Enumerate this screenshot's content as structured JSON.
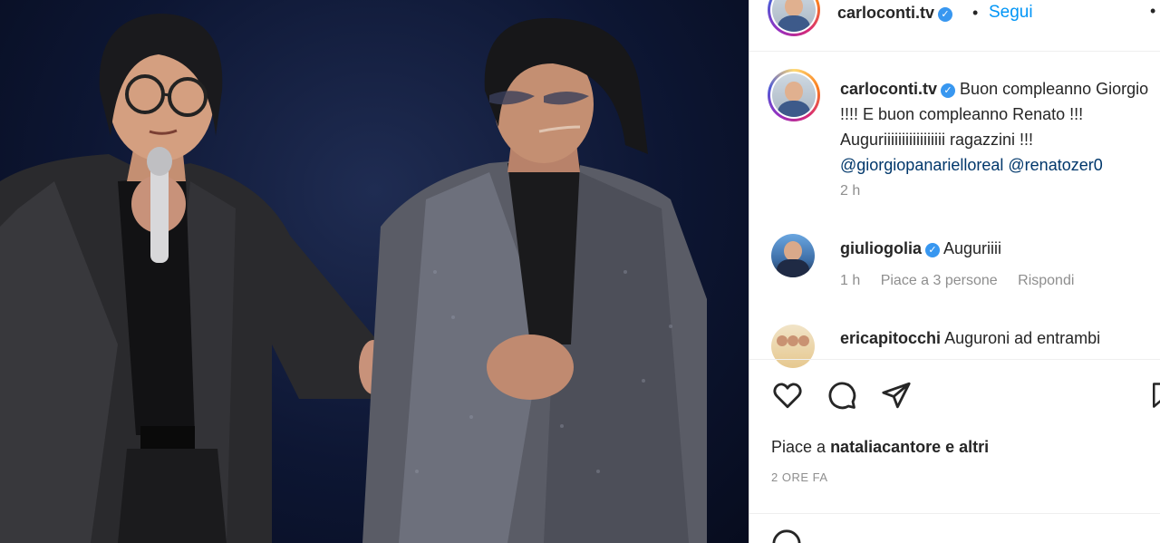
{
  "post": {
    "username": "carloconti.tv",
    "follow_label": "Segui",
    "separator": "•",
    "more_label": "•",
    "caption_text": "Buon compleanno Giorgio !!!! E buon compleanno Renato !!! Auguriiiiiiiiiiiiiiiii ragazzini !!!",
    "caption_tags": [
      "@giorgiopanarielloreal",
      "@renatozer0"
    ],
    "caption_time": "2 h"
  },
  "comments": [
    {
      "username": "giuliogolia",
      "verified": true,
      "text": "Auguriiii",
      "time": "1 h",
      "likes": "Piace a 3 persone",
      "reply": "Rispondi"
    },
    {
      "username": "ericapitocchi",
      "verified": false,
      "text": "Auguroni ad entrambi"
    }
  ],
  "actions": {
    "like_icon": "heart-icon",
    "comment_icon": "comment-icon",
    "share_icon": "share-icon",
    "save_icon": "bookmark-icon"
  },
  "likes": {
    "prefix": "Piace a",
    "user": "nataliacantore",
    "suffix": "e altri"
  },
  "timestamp": "2 ORE FA",
  "colors": {
    "accent": "#0095f6",
    "verified": "#3897f0",
    "mention": "#00376b",
    "muted": "#8e8e8e"
  }
}
